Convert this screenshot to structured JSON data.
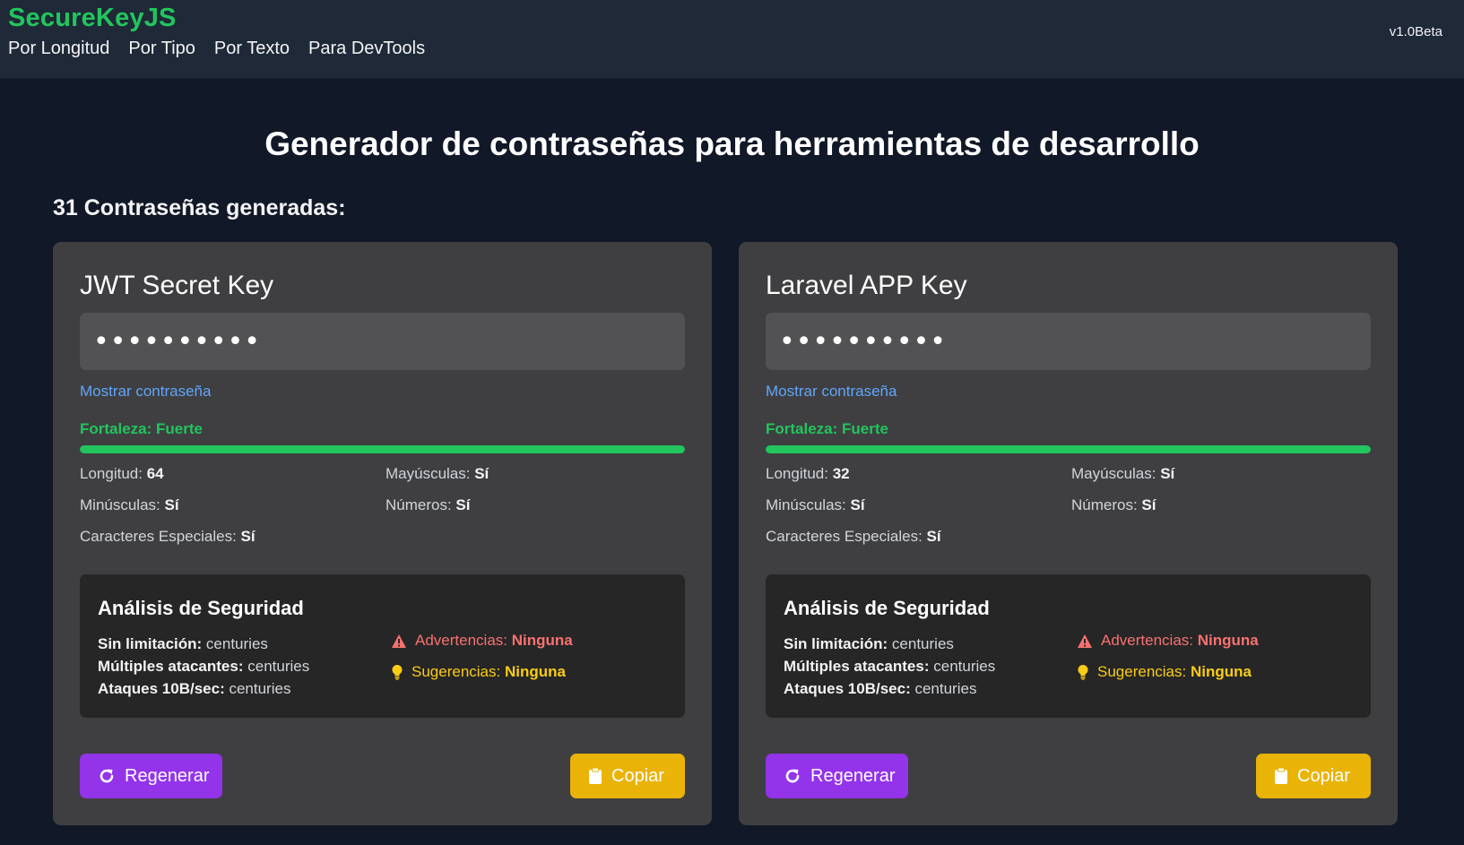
{
  "header": {
    "brand": "SecureKeyJS",
    "nav": [
      "Por Longitud",
      "Por Tipo",
      "Por Texto",
      "Para DevTools"
    ],
    "version": "v1.0Beta"
  },
  "main": {
    "title": "Generador de contraseñas para herramientas de desarrollo",
    "count_label": "31 Contraseñas generadas:"
  },
  "labels": {
    "show_password": "Mostrar contraseña",
    "length": "Longitud:",
    "uppercase": "Mayúsculas:",
    "lowercase": "Minúsculas:",
    "numbers": "Números:",
    "special": "Caracteres Especiales:",
    "security_title": "Análisis de Seguridad",
    "no_limit": "Sin limitación:",
    "multi_attackers": "Múltiples atacantes:",
    "attacks_10b": "Ataques 10B/sec:",
    "warnings": "Advertencias:",
    "suggestions": "Sugerencias:",
    "regenerate": "Regenerar",
    "copy": "Copiar"
  },
  "cards": [
    {
      "title": "JWT Secret Key",
      "password_mask": "••••••••••",
      "strength": "Fortaleza: Fuerte",
      "strength_fraction": 1.0,
      "length": "64",
      "uppercase": "Sí",
      "lowercase": "Sí",
      "numbers": "Sí",
      "special": "Sí",
      "no_limit": "centuries",
      "multi_attackers": "centuries",
      "attacks_10b": "centuries",
      "warnings": "Ninguna",
      "suggestions": "Ninguna"
    },
    {
      "title": "Laravel APP Key",
      "password_mask": "••••••••••",
      "strength": "Fortaleza: Fuerte",
      "strength_fraction": 1.0,
      "length": "32",
      "uppercase": "Sí",
      "lowercase": "Sí",
      "numbers": "Sí",
      "special": "Sí",
      "no_limit": "centuries",
      "multi_attackers": "centuries",
      "attacks_10b": "centuries",
      "warnings": "Ninguna",
      "suggestions": "Ninguna"
    }
  ],
  "icons": {
    "regenerate": "refresh-icon",
    "copy": "clipboard-icon",
    "warning": "warning-triangle-icon",
    "suggestion": "lightbulb-icon"
  },
  "colors": {
    "brand": "#22c55e",
    "strength": "#22c55e",
    "link": "#60a5fa",
    "warning": "#f87171",
    "suggestion": "#facc15",
    "regenerate_button": "#9333ea",
    "copy_button": "#eab308"
  }
}
